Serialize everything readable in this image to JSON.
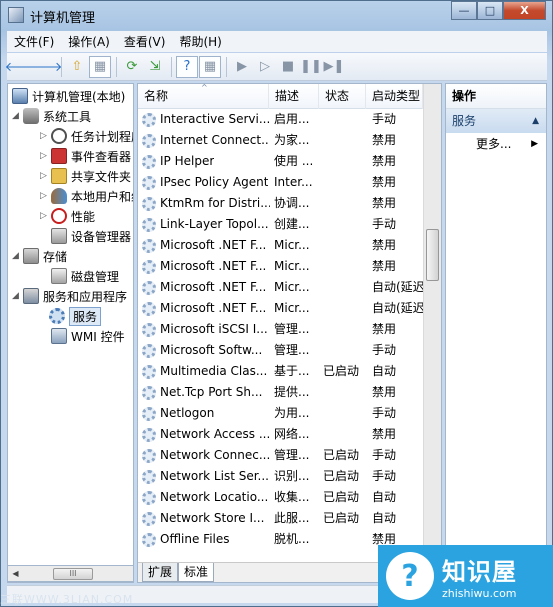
{
  "window": {
    "title": "计算机管理",
    "minimize": "—",
    "maximize": "□",
    "close": "X"
  },
  "menu": [
    "文件(F)",
    "操作(A)",
    "查看(V)",
    "帮助(H)"
  ],
  "toolbar": {
    "back": "🡐",
    "forward": "🡒",
    "up": "⇧",
    "show_hide": "▦",
    "refresh": "⟳",
    "export": "⇲",
    "help": "?",
    "properties": "▦",
    "start": "▶",
    "start2": "▷",
    "stop": "■",
    "pause": "❚❚",
    "restart": "▶❚"
  },
  "tree": {
    "root": "计算机管理(本地)",
    "system_tools": "系统工具",
    "task_scheduler": "任务计划程序",
    "event_viewer": "事件查看器",
    "shared_folders": "共享文件夹",
    "local_users": "本地用户和组",
    "performance": "性能",
    "device_manager": "设备管理器",
    "storage": "存储",
    "disk_management": "磁盘管理",
    "services_apps": "服务和应用程序",
    "services": "服务",
    "wmi": "WMI 控件"
  },
  "list": {
    "headers": {
      "name": "名称",
      "description": "描述",
      "status": "状态",
      "startup": "启动类型"
    },
    "rows": [
      {
        "name": "Interactive Servi...",
        "description": "启用...",
        "status": "",
        "startup": "手动"
      },
      {
        "name": "Internet Connect...",
        "description": "为家...",
        "status": "",
        "startup": "禁用"
      },
      {
        "name": "IP Helper",
        "description": "使用 ...",
        "status": "",
        "startup": "禁用"
      },
      {
        "name": "IPsec Policy Agent",
        "description": "Inter...",
        "status": "",
        "startup": "禁用"
      },
      {
        "name": "KtmRm for Distri...",
        "description": "协调...",
        "status": "",
        "startup": "禁用"
      },
      {
        "name": "Link-Layer Topol...",
        "description": "创建...",
        "status": "",
        "startup": "手动"
      },
      {
        "name": "Microsoft .NET F...",
        "description": "Micr...",
        "status": "",
        "startup": "禁用"
      },
      {
        "name": "Microsoft .NET F...",
        "description": "Micr...",
        "status": "",
        "startup": "禁用"
      },
      {
        "name": "Microsoft .NET F...",
        "description": "Micr...",
        "status": "",
        "startup": "自动(延迟"
      },
      {
        "name": "Microsoft .NET F...",
        "description": "Micr...",
        "status": "",
        "startup": "自动(延迟"
      },
      {
        "name": "Microsoft iSCSI I...",
        "description": "管理...",
        "status": "",
        "startup": "禁用"
      },
      {
        "name": "Microsoft Softw...",
        "description": "管理...",
        "status": "",
        "startup": "手动"
      },
      {
        "name": "Multimedia Clas...",
        "description": "基于...",
        "status": "已启动",
        "startup": "自动"
      },
      {
        "name": "Net.Tcp Port Sh...",
        "description": "提供...",
        "status": "",
        "startup": "禁用"
      },
      {
        "name": "Netlogon",
        "description": "为用...",
        "status": "",
        "startup": "手动"
      },
      {
        "name": "Network Access ...",
        "description": "网络...",
        "status": "",
        "startup": "禁用"
      },
      {
        "name": "Network Connec...",
        "description": "管理...",
        "status": "已启动",
        "startup": "手动"
      },
      {
        "name": "Network List Ser...",
        "description": "识别...",
        "status": "已启动",
        "startup": "手动"
      },
      {
        "name": "Network Locatio...",
        "description": "收集...",
        "status": "已启动",
        "startup": "自动"
      },
      {
        "name": "Network Store I...",
        "description": "此服...",
        "status": "已启动",
        "startup": "自动"
      },
      {
        "name": "Offline Files",
        "description": "脱机...",
        "status": "",
        "startup": "禁用"
      }
    ]
  },
  "tabs": {
    "expand": "扩展",
    "standard": "标准"
  },
  "actions": {
    "header": "操作",
    "section": "服务",
    "more": "更多..."
  },
  "watermark": {
    "title": "知识屋",
    "subtitle": "zhishiwu.com"
  },
  "source_mark": "三联WWW.3LIAN.COM"
}
